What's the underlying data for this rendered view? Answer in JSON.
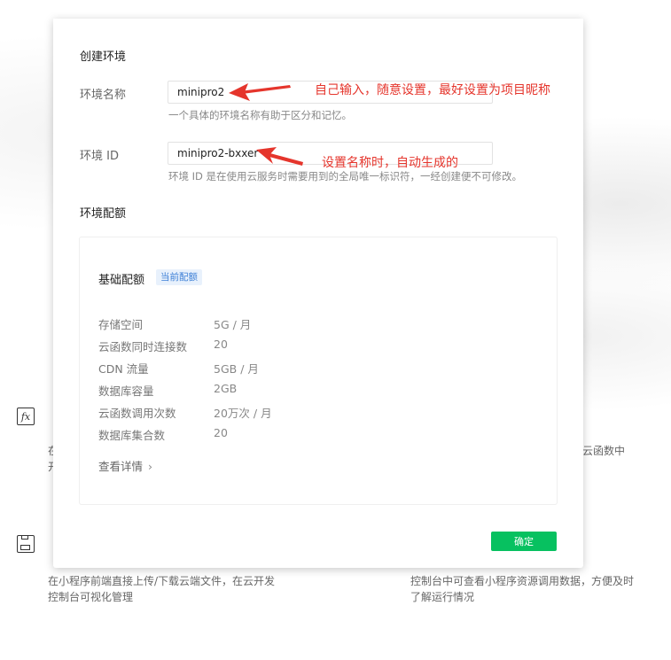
{
  "background": {
    "left_fragment": "在开",
    "right_fragment": "云函数中",
    "left_desc": "在小程序前端直接上传/下载云端文件，在云开发控制台可视化管理",
    "right_desc": "控制台中可查看小程序资源调用数据，方便及时了解运行情况",
    "fx_icon_text": "fx"
  },
  "modal": {
    "section_create": "创建环境",
    "env_name": {
      "label": "环境名称",
      "value": "minipro2",
      "hint": "一个具体的环境名称有助于区分和记忆。"
    },
    "env_id": {
      "label": "环境 ID",
      "value": "minipro2-bxxer",
      "hint": "环境 ID 是在使用云服务时需要用到的全局唯一标识符，一经创建便不可修改。"
    },
    "section_quota": "环境配额",
    "quota": {
      "plan_name": "基础配额",
      "badge": "当前配额",
      "rows": [
        {
          "key": "存储空间",
          "value": "5G / 月"
        },
        {
          "key": "云函数同时连接数",
          "value": "20"
        },
        {
          "key": "CDN 流量",
          "value": "5GB / 月"
        },
        {
          "key": "数据库容量",
          "value": "2GB"
        },
        {
          "key": "云函数调用次数",
          "value": "20万次 / 月"
        },
        {
          "key": "数据库集合数",
          "value": "20"
        }
      ],
      "details_link": "查看详情",
      "details_chevron": "›"
    },
    "confirm_button": "确定"
  },
  "annotations": {
    "note_name": "自己输入，随意设置，最好设置为项目昵称",
    "note_id": "设置名称时，自动生成的",
    "color": "#e5352c"
  },
  "colors": {
    "primary_button": "#07c160",
    "badge_text": "#3c7fd6",
    "badge_bg": "#e8f1fc"
  }
}
